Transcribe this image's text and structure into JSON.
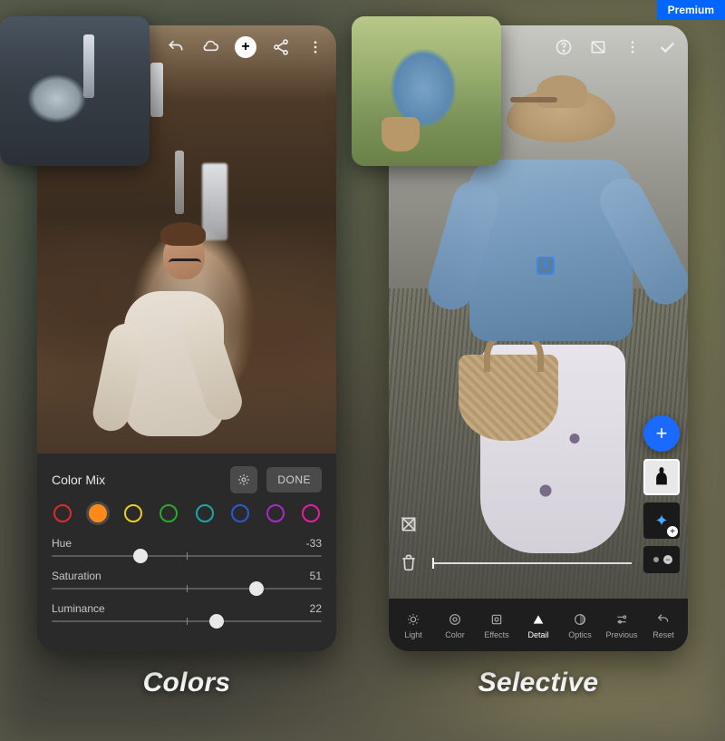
{
  "premium_badge": "Premium",
  "left": {
    "caption": "Colors",
    "panel": {
      "title": "Color Mix",
      "done": "DONE",
      "swatches": [
        {
          "color": "#e02a2a",
          "selected": false
        },
        {
          "color": "#ff8a1a",
          "selected": true
        },
        {
          "color": "#e8d020",
          "selected": false
        },
        {
          "color": "#2aa82a",
          "selected": false
        },
        {
          "color": "#1aa8a8",
          "selected": false
        },
        {
          "color": "#2a58d8",
          "selected": false
        },
        {
          "color": "#a82ac8",
          "selected": false
        },
        {
          "color": "#e81aa8",
          "selected": false
        }
      ],
      "sliders": [
        {
          "label": "Hue",
          "value": -33,
          "pos": 33
        },
        {
          "label": "Saturation",
          "value": 51,
          "pos": 76
        },
        {
          "label": "Luminance",
          "value": 22,
          "pos": 61
        }
      ]
    }
  },
  "right": {
    "caption": "Selective",
    "tools": [
      {
        "label": "Light",
        "icon": "sun"
      },
      {
        "label": "Color",
        "icon": "palette"
      },
      {
        "label": "Effects",
        "icon": "aperture"
      },
      {
        "label": "Detail",
        "icon": "triangle",
        "active": true
      },
      {
        "label": "Optics",
        "icon": "lens"
      },
      {
        "label": "Previous",
        "icon": "sliders"
      },
      {
        "label": "Reset",
        "icon": "undo"
      }
    ]
  }
}
